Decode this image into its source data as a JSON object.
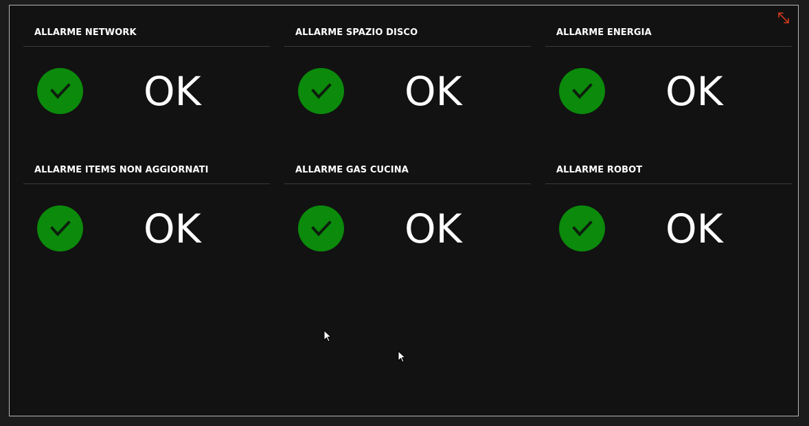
{
  "colors": {
    "background": "#121212",
    "border": "#b8b8b8",
    "status_ok": "#0b8a0b",
    "expand_icon": "#d23b1a"
  },
  "tiles": [
    {
      "title": "ALLARME NETWORK",
      "status": "OK",
      "icon": "checkmark-circle-icon"
    },
    {
      "title": "ALLARME SPAZIO DISCO",
      "status": "OK",
      "icon": "checkmark-circle-icon"
    },
    {
      "title": "ALLARME ENERGIA",
      "status": "OK",
      "icon": "checkmark-circle-icon"
    },
    {
      "title": "ALLARME ITEMS NON AGGIORNATI",
      "status": "OK",
      "icon": "checkmark-circle-icon"
    },
    {
      "title": "ALLARME GAS CUCINA",
      "status": "OK",
      "icon": "checkmark-circle-icon"
    },
    {
      "title": "ALLARME ROBOT",
      "status": "OK",
      "icon": "checkmark-circle-icon"
    }
  ],
  "toolbar": {
    "expand_icon": "expand-icon"
  }
}
